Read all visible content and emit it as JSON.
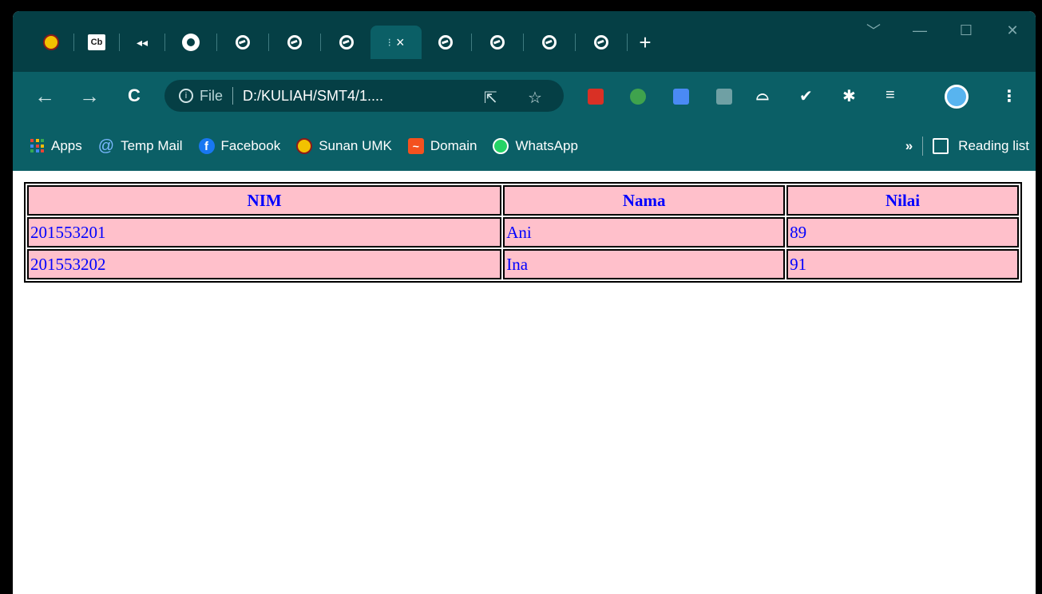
{
  "browser": {
    "tabs": [
      {
        "icon": "umk-logo-icon"
      },
      {
        "icon": "cb-icon",
        "text": "Cb"
      },
      {
        "icon": "audio-icon",
        "text": "◂◂"
      },
      {
        "icon": "github-icon"
      },
      {
        "icon": "globe-icon"
      },
      {
        "icon": "globe-icon"
      },
      {
        "icon": "globe-icon"
      },
      {
        "icon": "active-tab",
        "text": "×",
        "active": true
      },
      {
        "icon": "globe-icon"
      },
      {
        "icon": "globe-icon"
      },
      {
        "icon": "globe-icon"
      },
      {
        "icon": "globe-icon"
      }
    ],
    "new_tab": "+",
    "window_controls": {
      "tab_search": "﹀",
      "minimize": "—",
      "maximize": "☐",
      "close": "✕"
    },
    "nav": {
      "back": "←",
      "forward": "→",
      "reload": "C"
    },
    "address": {
      "info": "i",
      "scheme": "File",
      "url": "D:/KULIAH/SMT4/1...."
    },
    "bookmarks": [
      {
        "label": "Apps",
        "icon": "apps-grid-icon"
      },
      {
        "label": "Temp Mail",
        "icon": "at-icon"
      },
      {
        "label": "Facebook",
        "icon": "facebook-icon"
      },
      {
        "label": "Sunan UMK",
        "icon": "umk-logo-icon"
      },
      {
        "label": "Domain",
        "icon": "domain-icon"
      },
      {
        "label": "WhatsApp",
        "icon": "whatsapp-icon"
      }
    ],
    "bookmarks_overflow": "»",
    "reading_list": "Reading list"
  },
  "table": {
    "headers": [
      "NIM",
      "Nama",
      "Nilai"
    ],
    "rows": [
      [
        "201553201",
        "Ani",
        "89"
      ],
      [
        "201553202",
        "Ina",
        "91"
      ]
    ]
  },
  "colors": {
    "titlebar": "#053f45",
    "toolbar": "#0b5f66",
    "cell_background": "#ffc0cb",
    "cell_text": "#0000ff"
  }
}
